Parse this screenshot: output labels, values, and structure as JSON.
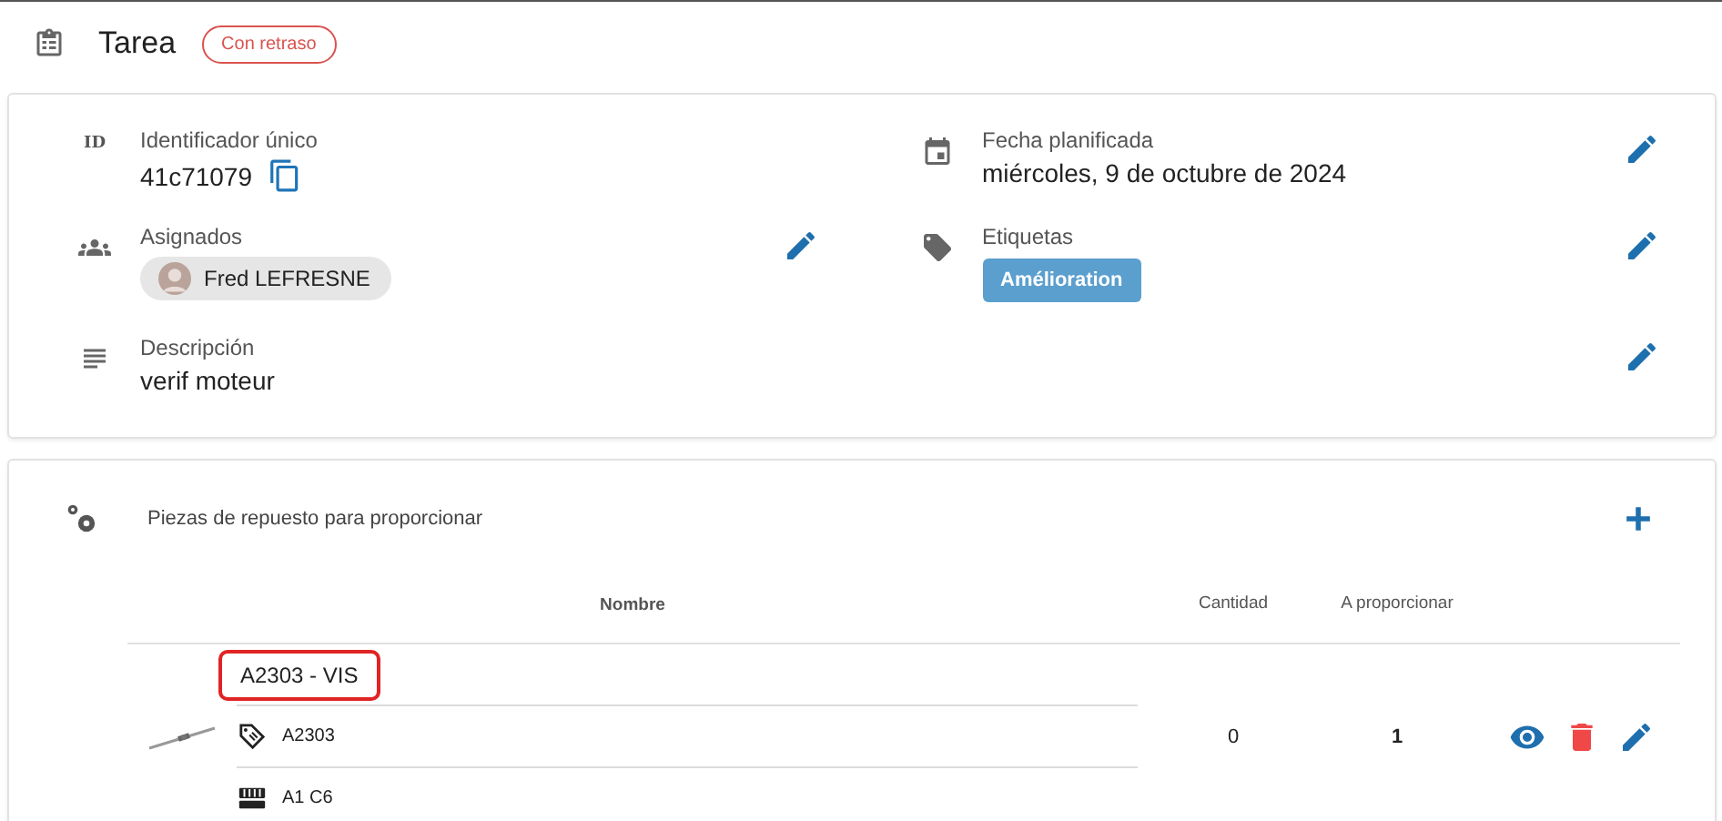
{
  "header": {
    "title": "Tarea",
    "status": "Con retraso"
  },
  "fields": [
    {
      "kind": "id",
      "label": "Identificador único",
      "value": "41c71079",
      "icon_text": "ID",
      "editable": false
    },
    {
      "kind": "date",
      "label": "Fecha planificada",
      "value": "miércoles, 9 de octubre de 2024",
      "editable": true
    },
    {
      "kind": "people",
      "label": "Asignados",
      "people": [
        "Fred LEFRESNE"
      ],
      "editable": true
    },
    {
      "kind": "tags",
      "label": "Etiquetas",
      "tags": [
        {
          "label": "Amélioration",
          "color": "#5b9fce"
        }
      ],
      "editable": true
    },
    {
      "kind": "description",
      "label": "Descripción",
      "value": "verif moteur",
      "editable": true
    }
  ],
  "parts": {
    "title": "Piezas de repuesto para proporcionar",
    "columns": [
      "Nombre",
      "Cantidad",
      "A proporcionar"
    ],
    "rows": [
      {
        "name": "A2303 - VIS",
        "highlighted": true,
        "reference": "A2303",
        "location": "A1 C6",
        "quantity": "0",
        "to_provide": "1"
      }
    ]
  }
}
